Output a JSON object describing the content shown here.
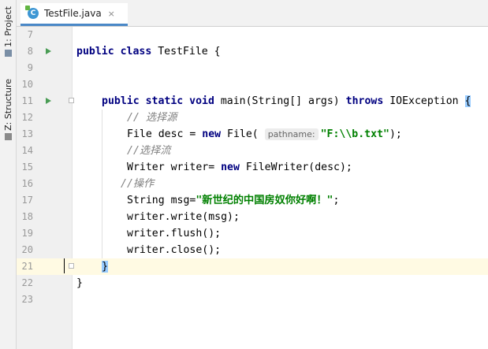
{
  "sidebar": {
    "project_label": "1: Project",
    "structure_label": "Z: Structure"
  },
  "tab": {
    "file_icon": "java-class-icon",
    "label": "TestFile.java",
    "close": "×"
  },
  "colors": {
    "keyword": "#000080",
    "comment": "#808080",
    "string": "#008000",
    "current_line": "#fffae3",
    "run_icon": "#499c54",
    "brace_highlight": "#99ccff"
  },
  "lines": [
    {
      "num": "7"
    },
    {
      "num": "8",
      "kw": "public class ",
      "rest": "TestFile {"
    },
    {
      "num": "9"
    },
    {
      "num": "10"
    },
    {
      "num": "11",
      "kw1": "public static void ",
      "mid": "main(String[] args) ",
      "kw2": "throws",
      "rest": " IOException ",
      "brace": "{"
    },
    {
      "num": "12",
      "comment": "// 选择源"
    },
    {
      "num": "13",
      "a": "File desc = ",
      "kw": "new",
      "b": " File( ",
      "hint": "pathname:",
      "str": "\"F:\\\\b.txt\"",
      "c": ");"
    },
    {
      "num": "14",
      "comment": "//选择流"
    },
    {
      "num": "15",
      "a": "Writer writer= ",
      "kw": "new",
      "b": " FileWriter(desc);"
    },
    {
      "num": "16",
      "comment": "//操作"
    },
    {
      "num": "17",
      "a": "String msg=",
      "str": "\"新世纪的中国房奴你好啊！\"",
      "b": ";"
    },
    {
      "num": "18",
      "text": "writer.write(msg);"
    },
    {
      "num": "19",
      "text": "writer.flush();"
    },
    {
      "num": "20",
      "text": "writer.close();"
    },
    {
      "num": "21",
      "brace": "}"
    },
    {
      "num": "22",
      "text": "}"
    },
    {
      "num": "23"
    }
  ]
}
